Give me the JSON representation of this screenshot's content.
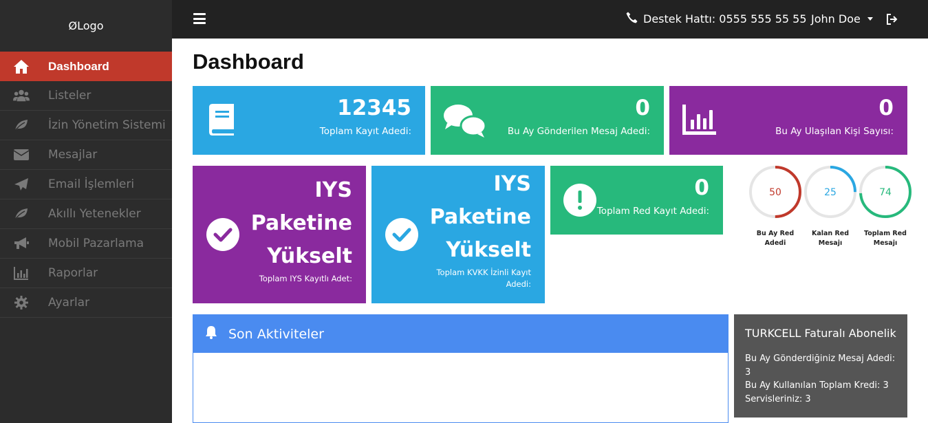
{
  "sidebar": {
    "logo": "ØLogo",
    "items": [
      {
        "label": "Dashboard",
        "icon": "home-icon",
        "active": true
      },
      {
        "label": "Listeler",
        "icon": "users-icon"
      },
      {
        "label": "İzin Yönetim Sistemi",
        "icon": "leaf-icon"
      },
      {
        "label": "Mesajlar",
        "icon": "envelope-icon"
      },
      {
        "label": "Email İşlemleri",
        "icon": "paper-plane-icon"
      },
      {
        "label": "Akıllı Yetenekler",
        "icon": "leaf-icon"
      },
      {
        "label": "Mobil Pazarlama",
        "icon": "bullhorn-icon"
      },
      {
        "label": "Raporlar",
        "icon": "chart-icon"
      },
      {
        "label": "Ayarlar",
        "icon": "gear-icon"
      }
    ]
  },
  "topbar": {
    "support": "Destek Hattı: 0555 555 55 55",
    "user": "John Doe"
  },
  "page": {
    "title": "Dashboard"
  },
  "stats": [
    {
      "value": "12345",
      "label": "Toplam Kayıt Adedi:",
      "icon": "book-icon",
      "color": "#2aa7e2"
    },
    {
      "value": "0",
      "label": "Bu Ay Gönderilen Mesaj Adedi:",
      "icon": "comments-icon",
      "color": "#27b97c"
    },
    {
      "value": "0",
      "label": "Bu Ay Ulaşılan Kişi Sayısı:",
      "icon": "bar-chart-icon",
      "color": "#8a2a9e"
    }
  ],
  "iys": [
    {
      "line1": "IYS",
      "line2": "Paketine",
      "line3": "Yükselt",
      "sub": "Toplam IYS Kayıtlı Adet:",
      "color": "#8a2a9e"
    },
    {
      "line1": "IYS",
      "line2": "Paketine",
      "line3": "Yükselt",
      "sub1": "Toplam KVKK İzinli Kayıt",
      "sub2": "Adedi:",
      "color": "#2aa7e2"
    }
  ],
  "red": {
    "value": "0",
    "label": "Toplam Red Kayıt Adedi:",
    "color": "#27b97c"
  },
  "gauges": [
    {
      "value": "50",
      "fraction": 0.5,
      "color": "#c0392b",
      "label1": "Bu Ay Red",
      "label2": "Adedi"
    },
    {
      "value": "25",
      "fraction": 0.25,
      "color": "#2aa7e2",
      "label1": "Kalan Red",
      "label2": "Mesajı"
    },
    {
      "value": "74",
      "fraction": 0.74,
      "color": "#27b97c",
      "label1": "Toplam Red",
      "label2": "Mesajı"
    }
  ],
  "activity": {
    "title": "Son Aktiviteler"
  },
  "turkcell": {
    "title": "TURKCELL Faturalı Abonelik",
    "line1": "Bu Ay Gönderdiğiniz Mesaj Adedi: 3",
    "line2": "Bu Ay Kullanılan Toplam Kredi: 3",
    "line3": "Servisleriniz: 3"
  }
}
